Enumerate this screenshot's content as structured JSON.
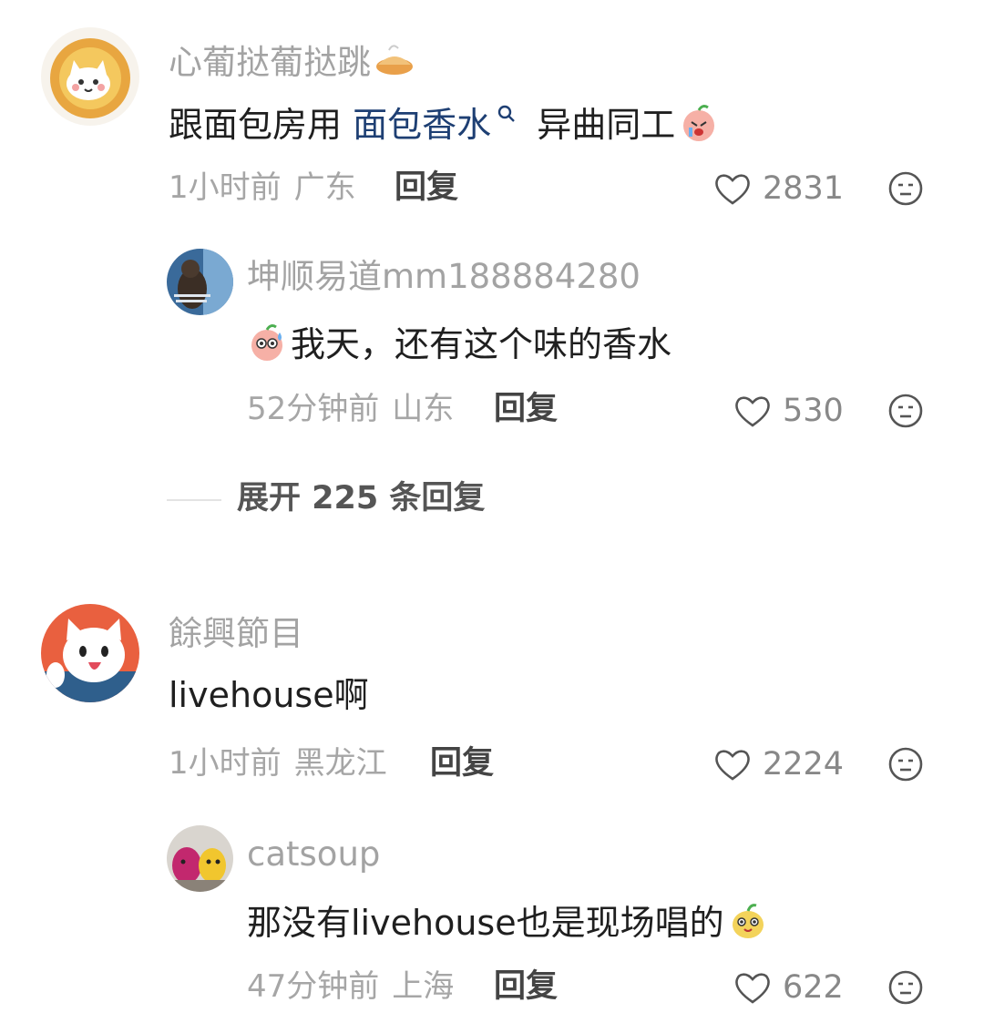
{
  "comments": [
    {
      "username": "心葡挞葡挞跳",
      "username_emoji": "pie-emoji",
      "text_before": "跟面包房用 ",
      "link_text": "面包香水",
      "text_after": " 异曲同工",
      "emoji": "crying-peach-emoji",
      "time": "1小时前",
      "location": "广东",
      "reply_label": "回复",
      "likes": "2831",
      "replies": [
        {
          "username": "坤顺易道mm188884280",
          "emoji": "sweat-peach-emoji",
          "text": "我天，还有这个味的香水",
          "time": "52分钟前",
          "location": "山东",
          "reply_label": "回复",
          "likes": "530"
        }
      ],
      "expand_label": "展开 225 条回复"
    },
    {
      "username": "餘興節目",
      "text": "livehouse啊",
      "time": "1小时前",
      "location": "黑龙江",
      "reply_label": "回复",
      "likes": "2224",
      "replies": [
        {
          "username": "catsoup",
          "text": "那没有livehouse也是现场唱的",
          "emoji": "smiling-pear-emoji",
          "time": "47分钟前",
          "location": "上海",
          "reply_label": "回复",
          "likes": "622"
        }
      ]
    }
  ],
  "colors": {
    "username": "#a3a3a3",
    "text": "#1f1f1f",
    "link": "#1e3f73",
    "meta": "#a6a6a6"
  }
}
